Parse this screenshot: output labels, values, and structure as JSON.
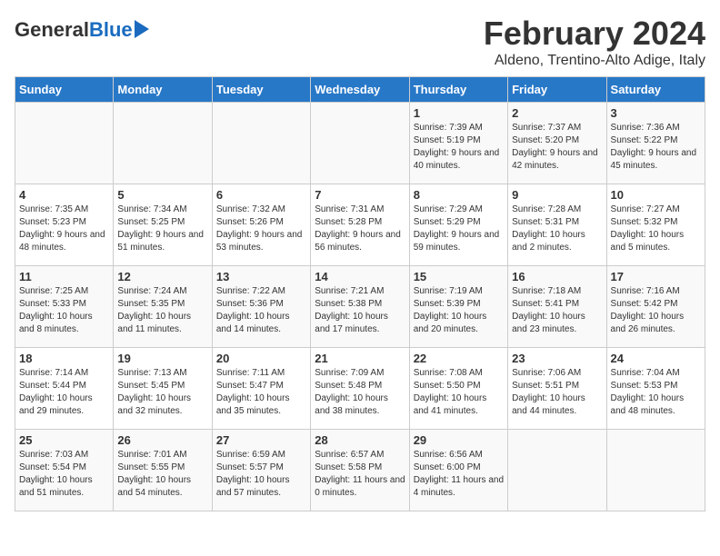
{
  "logo": {
    "general": "General",
    "blue": "Blue"
  },
  "title": "February 2024",
  "subtitle": "Aldeno, Trentino-Alto Adige, Italy",
  "days_header": [
    "Sunday",
    "Monday",
    "Tuesday",
    "Wednesday",
    "Thursday",
    "Friday",
    "Saturday"
  ],
  "weeks": [
    [
      {
        "day": "",
        "sunrise": "",
        "sunset": "",
        "daylight": ""
      },
      {
        "day": "",
        "sunrise": "",
        "sunset": "",
        "daylight": ""
      },
      {
        "day": "",
        "sunrise": "",
        "sunset": "",
        "daylight": ""
      },
      {
        "day": "",
        "sunrise": "",
        "sunset": "",
        "daylight": ""
      },
      {
        "day": "1",
        "sunrise": "Sunrise: 7:39 AM",
        "sunset": "Sunset: 5:19 PM",
        "daylight": "Daylight: 9 hours and 40 minutes."
      },
      {
        "day": "2",
        "sunrise": "Sunrise: 7:37 AM",
        "sunset": "Sunset: 5:20 PM",
        "daylight": "Daylight: 9 hours and 42 minutes."
      },
      {
        "day": "3",
        "sunrise": "Sunrise: 7:36 AM",
        "sunset": "Sunset: 5:22 PM",
        "daylight": "Daylight: 9 hours and 45 minutes."
      }
    ],
    [
      {
        "day": "4",
        "sunrise": "Sunrise: 7:35 AM",
        "sunset": "Sunset: 5:23 PM",
        "daylight": "Daylight: 9 hours and 48 minutes."
      },
      {
        "day": "5",
        "sunrise": "Sunrise: 7:34 AM",
        "sunset": "Sunset: 5:25 PM",
        "daylight": "Daylight: 9 hours and 51 minutes."
      },
      {
        "day": "6",
        "sunrise": "Sunrise: 7:32 AM",
        "sunset": "Sunset: 5:26 PM",
        "daylight": "Daylight: 9 hours and 53 minutes."
      },
      {
        "day": "7",
        "sunrise": "Sunrise: 7:31 AM",
        "sunset": "Sunset: 5:28 PM",
        "daylight": "Daylight: 9 hours and 56 minutes."
      },
      {
        "day": "8",
        "sunrise": "Sunrise: 7:29 AM",
        "sunset": "Sunset: 5:29 PM",
        "daylight": "Daylight: 9 hours and 59 minutes."
      },
      {
        "day": "9",
        "sunrise": "Sunrise: 7:28 AM",
        "sunset": "Sunset: 5:31 PM",
        "daylight": "Daylight: 10 hours and 2 minutes."
      },
      {
        "day": "10",
        "sunrise": "Sunrise: 7:27 AM",
        "sunset": "Sunset: 5:32 PM",
        "daylight": "Daylight: 10 hours and 5 minutes."
      }
    ],
    [
      {
        "day": "11",
        "sunrise": "Sunrise: 7:25 AM",
        "sunset": "Sunset: 5:33 PM",
        "daylight": "Daylight: 10 hours and 8 minutes."
      },
      {
        "day": "12",
        "sunrise": "Sunrise: 7:24 AM",
        "sunset": "Sunset: 5:35 PM",
        "daylight": "Daylight: 10 hours and 11 minutes."
      },
      {
        "day": "13",
        "sunrise": "Sunrise: 7:22 AM",
        "sunset": "Sunset: 5:36 PM",
        "daylight": "Daylight: 10 hours and 14 minutes."
      },
      {
        "day": "14",
        "sunrise": "Sunrise: 7:21 AM",
        "sunset": "Sunset: 5:38 PM",
        "daylight": "Daylight: 10 hours and 17 minutes."
      },
      {
        "day": "15",
        "sunrise": "Sunrise: 7:19 AM",
        "sunset": "Sunset: 5:39 PM",
        "daylight": "Daylight: 10 hours and 20 minutes."
      },
      {
        "day": "16",
        "sunrise": "Sunrise: 7:18 AM",
        "sunset": "Sunset: 5:41 PM",
        "daylight": "Daylight: 10 hours and 23 minutes."
      },
      {
        "day": "17",
        "sunrise": "Sunrise: 7:16 AM",
        "sunset": "Sunset: 5:42 PM",
        "daylight": "Daylight: 10 hours and 26 minutes."
      }
    ],
    [
      {
        "day": "18",
        "sunrise": "Sunrise: 7:14 AM",
        "sunset": "Sunset: 5:44 PM",
        "daylight": "Daylight: 10 hours and 29 minutes."
      },
      {
        "day": "19",
        "sunrise": "Sunrise: 7:13 AM",
        "sunset": "Sunset: 5:45 PM",
        "daylight": "Daylight: 10 hours and 32 minutes."
      },
      {
        "day": "20",
        "sunrise": "Sunrise: 7:11 AM",
        "sunset": "Sunset: 5:47 PM",
        "daylight": "Daylight: 10 hours and 35 minutes."
      },
      {
        "day": "21",
        "sunrise": "Sunrise: 7:09 AM",
        "sunset": "Sunset: 5:48 PM",
        "daylight": "Daylight: 10 hours and 38 minutes."
      },
      {
        "day": "22",
        "sunrise": "Sunrise: 7:08 AM",
        "sunset": "Sunset: 5:50 PM",
        "daylight": "Daylight: 10 hours and 41 minutes."
      },
      {
        "day": "23",
        "sunrise": "Sunrise: 7:06 AM",
        "sunset": "Sunset: 5:51 PM",
        "daylight": "Daylight: 10 hours and 44 minutes."
      },
      {
        "day": "24",
        "sunrise": "Sunrise: 7:04 AM",
        "sunset": "Sunset: 5:53 PM",
        "daylight": "Daylight: 10 hours and 48 minutes."
      }
    ],
    [
      {
        "day": "25",
        "sunrise": "Sunrise: 7:03 AM",
        "sunset": "Sunset: 5:54 PM",
        "daylight": "Daylight: 10 hours and 51 minutes."
      },
      {
        "day": "26",
        "sunrise": "Sunrise: 7:01 AM",
        "sunset": "Sunset: 5:55 PM",
        "daylight": "Daylight: 10 hours and 54 minutes."
      },
      {
        "day": "27",
        "sunrise": "Sunrise: 6:59 AM",
        "sunset": "Sunset: 5:57 PM",
        "daylight": "Daylight: 10 hours and 57 minutes."
      },
      {
        "day": "28",
        "sunrise": "Sunrise: 6:57 AM",
        "sunset": "Sunset: 5:58 PM",
        "daylight": "Daylight: 11 hours and 0 minutes."
      },
      {
        "day": "29",
        "sunrise": "Sunrise: 6:56 AM",
        "sunset": "Sunset: 6:00 PM",
        "daylight": "Daylight: 11 hours and 4 minutes."
      },
      {
        "day": "",
        "sunrise": "",
        "sunset": "",
        "daylight": ""
      },
      {
        "day": "",
        "sunrise": "",
        "sunset": "",
        "daylight": ""
      }
    ]
  ]
}
